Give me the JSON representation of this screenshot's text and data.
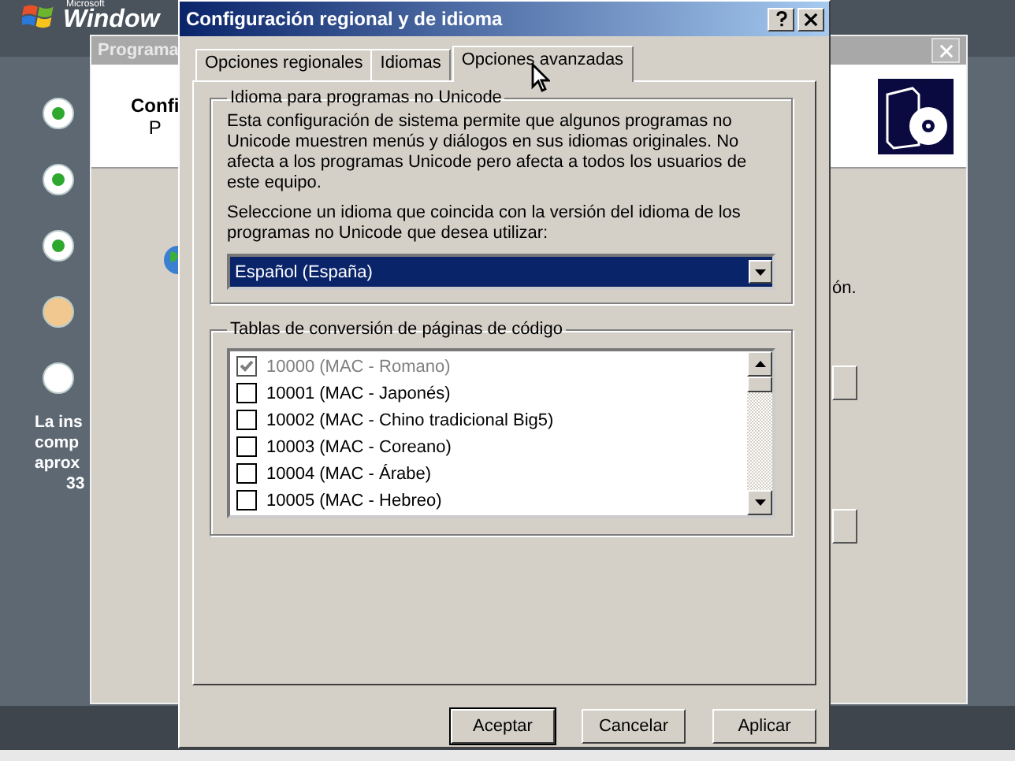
{
  "background": {
    "logo_brand": "Microsoft",
    "logo": "Window",
    "steps": [
      {
        "done": true,
        "current": false
      },
      {
        "done": true,
        "current": false
      },
      {
        "done": true,
        "current": false
      },
      {
        "done": false,
        "current": true
      },
      {
        "done": false,
        "current": false
      }
    ],
    "sidebar_text": [
      "La ins",
      "comp",
      "aprox",
      "33"
    ],
    "window": {
      "title": "Programa",
      "heading": "Confi",
      "subheading": "P",
      "body_fragment": "ón."
    }
  },
  "dialog": {
    "title": "Configuración regional y de idioma",
    "tabs": [
      {
        "label": "Opciones regionales",
        "selected": false
      },
      {
        "label": "Idiomas",
        "selected": false
      },
      {
        "label": "Opciones avanzadas",
        "selected": true
      }
    ],
    "unicode_group": {
      "title": "Idioma para programas no Unicode",
      "description": "Esta configuración de sistema permite que algunos programas no Unicode muestren menús y diálogos en sus idiomas originales. No afecta a los programas Unicode pero afecta a todos los usuarios de este equipo.",
      "instruction": "Seleccione un idioma que coincida con la versión del idioma de los programas no Unicode que desea utilizar:",
      "language": "Español (España)"
    },
    "code_pages": {
      "title": "Tablas de conversión de páginas de código",
      "items": [
        {
          "label": "10000 (MAC - Romano)",
          "checked": true,
          "disabled": true
        },
        {
          "label": "10001 (MAC - Japonés)",
          "checked": false,
          "disabled": false
        },
        {
          "label": "10002 (MAC - Chino tradicional Big5)",
          "checked": false,
          "disabled": false
        },
        {
          "label": "10003 (MAC - Coreano)",
          "checked": false,
          "disabled": false
        },
        {
          "label": "10004 (MAC - Árabe)",
          "checked": false,
          "disabled": false
        },
        {
          "label": "10005 (MAC - Hebreo)",
          "checked": false,
          "disabled": false
        }
      ]
    },
    "buttons": [
      {
        "label": "Aceptar",
        "default": true
      },
      {
        "label": "Cancelar",
        "default": false
      },
      {
        "label": "Aplicar",
        "default": false
      }
    ]
  }
}
